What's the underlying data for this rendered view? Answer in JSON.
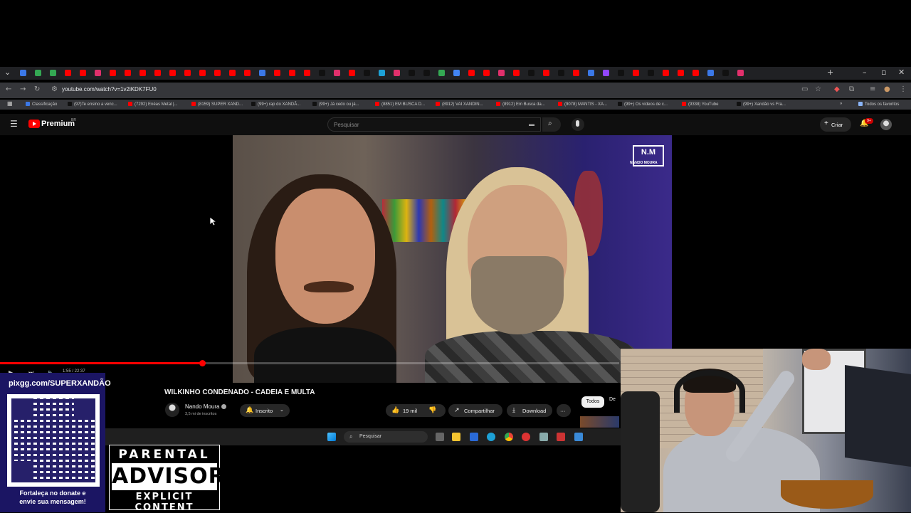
{
  "browser": {
    "url": "youtube.com/watch?v=1v2iKDK7FU0",
    "bookmarks": [
      {
        "label": "Classificação",
        "color": "#3b78e7"
      },
      {
        "label": "(97)Te ensino a venc...",
        "color": "#111111"
      },
      {
        "label": "(7292) Enéas Metal |...",
        "color": "#ff0000"
      },
      {
        "label": "(8159) SUPER XAND...",
        "color": "#ff0000"
      },
      {
        "label": "(99+) rap do XANDÃ...",
        "color": "#111111"
      },
      {
        "label": "(99+) Já cedo ou já...",
        "color": "#111111"
      },
      {
        "label": "(8851) EM BUSCA D...",
        "color": "#ff0000"
      },
      {
        "label": "(8912) VAI XANDIN...",
        "color": "#ff0000"
      },
      {
        "label": "(8912) Em Busca da...",
        "color": "#ff0000"
      },
      {
        "label": "(9078) MANTIS - XA...",
        "color": "#ff0000"
      },
      {
        "label": "(99+) Os vídeos de c...",
        "color": "#111111"
      },
      {
        "label": "(9338) YouTube",
        "color": "#ff0000"
      },
      {
        "label": "(99+) Xandão vs Fra...",
        "color": "#111111"
      }
    ],
    "all_favorites": "Todos os favoritos"
  },
  "youtube": {
    "brand": "Premium",
    "brand_region": "BR",
    "search_placeholder": "Pesquisar",
    "create_label": "Criar",
    "notif_count": "9+"
  },
  "player": {
    "progress_fraction": 0.326,
    "time": "1:55 / 22:37",
    "logo_text": "N.M",
    "logo_sub": "NANDO MOURA"
  },
  "video": {
    "title": "WILKINHO CONDENADO - CADEIA E MULTA",
    "channel": "Nando Moura",
    "subscribers": "3,5 mi de inscritos",
    "subscribe_state": "Inscrito",
    "likes": "19 mil",
    "share": "Compartilhar",
    "download": "Download",
    "chip_all": "Todos",
    "chip_next": "De"
  },
  "taskbar": {
    "search_label": "Pesquisar"
  },
  "overlays": {
    "qr_url": "pixgg.com/SUPERXANDÃO",
    "qr_message_1": "Fortaleça no donate e",
    "qr_message_2": "envie sua mensagem!",
    "advisory_1": "PARENTAL",
    "advisory_2": "ADVISORY",
    "advisory_3": "EXPLICIT CONTENT"
  }
}
